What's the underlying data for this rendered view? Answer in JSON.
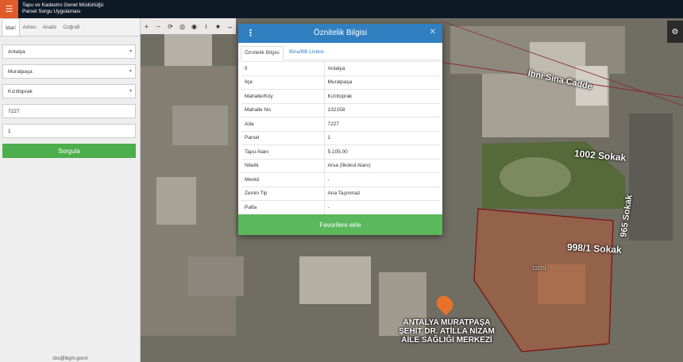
{
  "header": {
    "title_line1": "Tapu ve Kadastro Genel Müdürlüğü",
    "title_line2": "Parsel Sorgu Uygulaması"
  },
  "sidebar": {
    "tabs": [
      "İdari",
      "Adres",
      "Analiz",
      "Coğrafi"
    ],
    "fields": {
      "il": "Antalya",
      "ilce": "Muratpaşa",
      "mahalle": "Kızıltoprak",
      "ada": "7227",
      "parsel": "1"
    },
    "query_button": "Sorgula",
    "footer_email": "cbs@tkgm.gov.tr"
  },
  "map": {
    "streets": [
      "İbni Sina Cadde",
      "1002 Sokak",
      "965 Sokak",
      "998/1 Sokak"
    ],
    "poi_lines": [
      "ANTALYA MURATPAŞA",
      "ŞEHİT DR. ATİLLA NİZAM",
      "AİLE SAĞLIĞI MERKEZİ"
    ],
    "parcel_label": "7227/1"
  },
  "dialog": {
    "title": "Öznitelik Bilgisi",
    "tabs": [
      "Öznitelik Bilgisi",
      "Bina/BB Listesi"
    ],
    "rows": [
      {
        "key": "İl",
        "value": "Antalya"
      },
      {
        "key": "İlçe",
        "value": "Muratpaşa"
      },
      {
        "key": "Mahalle/Köy",
        "value": "Kızıltoprak"
      },
      {
        "key": "Mahalle No",
        "value": "132158"
      },
      {
        "key": "Ada",
        "value": "7227"
      },
      {
        "key": "Parsel",
        "value": "1"
      },
      {
        "key": "Tapu Alanı",
        "value": "5.105,00"
      },
      {
        "key": "Nitelik",
        "value": "Arsa (İlkokul Alanı)"
      },
      {
        "key": "Mevkii",
        "value": "-"
      },
      {
        "key": "Zemin Tip",
        "value": "Ana Taşınmaz"
      },
      {
        "key": "Pafta",
        "value": "-"
      }
    ],
    "fav_button": "Favorilere ekle",
    "close_icon": "close-icon",
    "menu_icon": "vertical-dots-icon"
  }
}
